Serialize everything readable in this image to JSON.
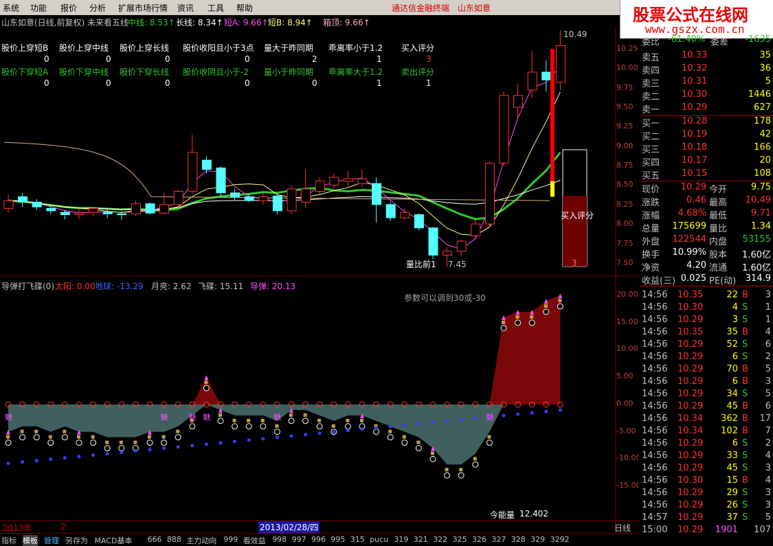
{
  "menu": {
    "items": [
      "系统",
      "功能",
      "报价",
      "分析",
      "扩展市场行情",
      "资讯",
      "工具",
      "帮助"
    ],
    "title_left": "通达信金融终端",
    "title_right": "山东如意"
  },
  "logo": {
    "line1": "股票公式在线网",
    "line2": "www.gszx.com.cn"
  },
  "main_chart": {
    "header": {
      "name": "山东如意(日线,前复权) 未来看五线",
      "mid_label": "中线: 8.53↑",
      "long_label": "长线: 8.34↑",
      "shortA_label": "短A: 9.66↑",
      "shortB_label": "短B: 8.94↑",
      "box_label": "箱顶: 9.66↑"
    },
    "table": {
      "buy_headers": [
        "股价上穿短B",
        "股价上穿中线",
        "股价上穿长线",
        "股价收阳且小于3点",
        "量大于昨同期",
        "乖离率小于1.2",
        "买入评分"
      ],
      "buy_values": [
        "0",
        "0",
        "0",
        "0",
        "2",
        "1",
        "3"
      ],
      "sell_headers": [
        "股价下穿短A",
        "股价下穿中线",
        "股价下穿长线",
        "股价收阴且小于-2",
        "量小于昨同期",
        "乖离率大于1.2",
        "卖出评分"
      ],
      "sell_values": [
        "0",
        "0",
        "0",
        "0",
        "0",
        "1",
        "1"
      ]
    },
    "price_axis": [
      "10.25",
      "10.00",
      "9.75",
      "9.50",
      "9.25",
      "9.00",
      "8.75",
      "8.50",
      "8.25",
      "8.00",
      "7.75",
      "7.50"
    ],
    "high_label": "10.49",
    "low_label": "7.45",
    "vol_ratio_label": "量比前1",
    "buy_score_label": "买入评分",
    "buy_score_value": "3",
    "colors": {
      "up": "#ff3232",
      "down": "#54ffff",
      "green_line": "#32c832",
      "yellow": "#ffff00"
    }
  },
  "indicator": {
    "title": "导弹打飞碟(0)",
    "sun": "太阳: 0.00",
    "earth": "地球: -13.29",
    "moon": "月亮: 2.62",
    "ufo": "飞碟: 15.11",
    "missile": "导弹: 20.13",
    "note": "参数可以调到30或-30",
    "axis": [
      "20.00",
      "15.00",
      "10.00",
      "5.00",
      "0.00",
      "-5.00",
      "-10.00",
      "-15.00"
    ],
    "energy_label": "今能量",
    "energy_value": "12.402",
    "marker": "魅"
  },
  "time_axis": {
    "year": "2013年",
    "num": "2",
    "date": "2013/02/28/四",
    "period": "日线"
  },
  "bottom_bar": {
    "items": [
      "指标",
      "模板",
      "管理",
      "另存为",
      "MACD基本",
      "666",
      "888",
      "主力动向",
      "999",
      "看效益",
      "998",
      "997",
      "996",
      "995",
      "315",
      "pucu",
      "319",
      "321",
      "322",
      "325",
      "326",
      "327",
      "328",
      "329",
      "3292"
    ]
  },
  "quote": {
    "weibi_label": "委比",
    "weibi": "-61.40%",
    "weicha_label": "委差",
    "weicha": "-1635",
    "asks": [
      {
        "label": "卖五",
        "price": "10.33",
        "vol": "35"
      },
      {
        "label": "卖四",
        "price": "10.32",
        "vol": "36"
      },
      {
        "label": "卖三",
        "price": "10.31",
        "vol": "5"
      },
      {
        "label": "卖二",
        "price": "10.30",
        "vol": "1446"
      },
      {
        "label": "卖一",
        "price": "10.29",
        "vol": "627"
      }
    ],
    "bids": [
      {
        "label": "买一",
        "price": "10.28",
        "vol": "178"
      },
      {
        "label": "买二",
        "price": "10.19",
        "vol": "42"
      },
      {
        "label": "买三",
        "price": "10.18",
        "vol": "166"
      },
      {
        "label": "买四",
        "price": "10.17",
        "vol": "20"
      },
      {
        "label": "买五",
        "price": "10.15",
        "vol": "108"
      }
    ],
    "stats": [
      {
        "l1": "现价",
        "v1": "10.29",
        "l2": "今开",
        "v2": "9.75"
      },
      {
        "l1": "涨跌",
        "v1": "0.46",
        "l2": "最高",
        "v2": "10.49"
      },
      {
        "l1": "涨幅",
        "v1": "4.68%",
        "l2": "最低",
        "v2": "9.71"
      },
      {
        "l1": "总量",
        "v1": "175699",
        "l2": "量比",
        "v2": "1.34"
      },
      {
        "l1": "外盘",
        "v1": "122544",
        "l2": "内盘",
        "v2": "53155"
      },
      {
        "l1": "换手",
        "v1": "10.99%",
        "l2": "股本",
        "v2": "1.60亿"
      },
      {
        "l1": "净资",
        "v1": "4.20",
        "l2": "流通",
        "v2": "1.60亿"
      },
      {
        "l1": "收益(三)",
        "v1": "0.025",
        "l2": "PE(动)",
        "v2": "314.9"
      }
    ],
    "ticks": [
      {
        "t": "14:56",
        "p": "10.35",
        "v": "22",
        "d": "B",
        "n": "3"
      },
      {
        "t": "14:56",
        "p": "10.30",
        "v": "4",
        "d": "S",
        "n": "1"
      },
      {
        "t": "14:56",
        "p": "10.29",
        "v": "3",
        "d": "S",
        "n": "1"
      },
      {
        "t": "14:56",
        "p": "10.35",
        "v": "35",
        "d": "B",
        "n": "4"
      },
      {
        "t": "14:56",
        "p": "10.29",
        "v": "52",
        "d": "S",
        "n": "6"
      },
      {
        "t": "14:56",
        "p": "10.29",
        "v": "6",
        "d": "S",
        "n": "2"
      },
      {
        "t": "14:56",
        "p": "10.29",
        "v": "70",
        "d": "B",
        "n": "5"
      },
      {
        "t": "14:56",
        "p": "10.29",
        "v": "6",
        "d": "B",
        "n": "3"
      },
      {
        "t": "14:56",
        "p": "10.29",
        "v": "34",
        "d": "S",
        "n": "5"
      },
      {
        "t": "14:56",
        "p": "10.29",
        "v": "45",
        "d": "B",
        "n": "6"
      },
      {
        "t": "14:56",
        "p": "10.34",
        "v": "362",
        "d": "B",
        "n": "17"
      },
      {
        "t": "14:56",
        "p": "10.34",
        "v": "102",
        "d": "B",
        "n": "7"
      },
      {
        "t": "14:56",
        "p": "10.29",
        "v": "6",
        "d": "S",
        "n": "2"
      },
      {
        "t": "14:56",
        "p": "10.29",
        "v": "33",
        "d": "S",
        "n": "4"
      },
      {
        "t": "14:56",
        "p": "10.29",
        "v": "45",
        "d": "S",
        "n": "3"
      },
      {
        "t": "14:56",
        "p": "10.30",
        "v": "15",
        "d": "B",
        "n": "4"
      },
      {
        "t": "14:56",
        "p": "10.29",
        "v": "29",
        "d": "S",
        "n": "3"
      },
      {
        "t": "14:56",
        "p": "10.29",
        "v": "26",
        "d": "S",
        "n": "3"
      },
      {
        "t": "14:57",
        "p": "10.29",
        "v": "37",
        "d": "S",
        "n": "5"
      },
      {
        "t": "15:00",
        "p": "10.29",
        "v": "1901",
        "d": "",
        "n": "107"
      }
    ]
  },
  "candles": [
    {
      "o": 8.2,
      "c": 8.3,
      "h": 8.38,
      "l": 8.15
    },
    {
      "o": 8.35,
      "c": 8.28,
      "h": 8.4,
      "l": 8.22
    },
    {
      "o": 8.28,
      "c": 8.22,
      "h": 8.32,
      "l": 8.18
    },
    {
      "o": 8.2,
      "c": 8.17,
      "h": 8.25,
      "l": 8.12
    },
    {
      "o": 8.15,
      "c": 8.12,
      "h": 8.18,
      "l": 8.06
    },
    {
      "o": 8.12,
      "c": 8.14,
      "h": 8.2,
      "l": 8.06
    },
    {
      "o": 8.15,
      "c": 8.2,
      "h": 8.22,
      "l": 8.1
    },
    {
      "o": 8.15,
      "c": 8.13,
      "h": 8.18,
      "l": 8.08
    },
    {
      "o": 8.13,
      "c": 8.12,
      "h": 8.16,
      "l": 8.05
    },
    {
      "o": 8.13,
      "c": 8.26,
      "h": 8.3,
      "l": 8.1
    },
    {
      "o": 8.26,
      "c": 8.14,
      "h": 8.28,
      "l": 8.12
    },
    {
      "o": 8.14,
      "c": 8.25,
      "h": 8.4,
      "l": 8.12
    },
    {
      "o": 8.25,
      "c": 8.42,
      "h": 8.44,
      "l": 8.2
    },
    {
      "o": 8.42,
      "c": 8.92,
      "h": 9.15,
      "l": 8.38
    },
    {
      "o": 8.82,
      "c": 8.7,
      "h": 8.87,
      "l": 8.65
    },
    {
      "o": 8.72,
      "c": 8.4,
      "h": 8.74,
      "l": 8.35
    },
    {
      "o": 8.4,
      "c": 8.35,
      "h": 8.45,
      "l": 8.3
    },
    {
      "o": 8.35,
      "c": 8.3,
      "h": 8.38,
      "l": 8.28
    },
    {
      "o": 8.3,
      "c": 8.35,
      "h": 8.4,
      "l": 8.25
    },
    {
      "o": 8.36,
      "c": 8.17,
      "h": 8.38,
      "l": 8.12
    },
    {
      "o": 8.17,
      "c": 8.45,
      "h": 8.5,
      "l": 8.12
    },
    {
      "o": 8.28,
      "c": 8.45,
      "h": 8.7,
      "l": 8.2
    },
    {
      "o": 8.42,
      "c": 8.55,
      "h": 8.6,
      "l": 8.38
    },
    {
      "o": 8.5,
      "c": 8.6,
      "h": 8.65,
      "l": 8.45
    },
    {
      "o": 8.55,
      "c": 8.58,
      "h": 8.68,
      "l": 8.48
    },
    {
      "o": 8.52,
      "c": 8.58,
      "h": 8.7,
      "l": 8.48
    },
    {
      "o": 8.52,
      "c": 8.25,
      "h": 8.6,
      "l": 8.02
    },
    {
      "o": 8.25,
      "c": 8.08,
      "h": 8.28,
      "l": 8.04
    },
    {
      "o": 8.08,
      "c": 8.15,
      "h": 8.2,
      "l": 8.06
    },
    {
      "o": 8.12,
      "c": 7.95,
      "h": 8.14,
      "l": 7.92
    },
    {
      "o": 7.95,
      "c": 7.6,
      "h": 7.96,
      "l": 7.55
    },
    {
      "o": 7.6,
      "c": 7.65,
      "h": 7.7,
      "l": 7.45
    },
    {
      "o": 7.65,
      "c": 7.78,
      "h": 7.8,
      "l": 7.58
    },
    {
      "o": 7.85,
      "c": 8.0,
      "h": 8.05,
      "l": 7.8
    },
    {
      "o": 8.0,
      "c": 8.78,
      "h": 8.8,
      "l": 7.95
    },
    {
      "o": 8.78,
      "c": 9.65,
      "h": 9.7,
      "l": 8.75
    },
    {
      "o": 9.5,
      "c": 9.65,
      "h": 9.8,
      "l": 9.35
    },
    {
      "o": 9.72,
      "c": 9.95,
      "h": 10.22,
      "l": 9.62
    },
    {
      "o": 9.95,
      "c": 9.85,
      "h": 10.1,
      "l": 9.7
    },
    {
      "o": 9.82,
      "c": 10.29,
      "h": 10.49,
      "l": 9.72
    }
  ]
}
